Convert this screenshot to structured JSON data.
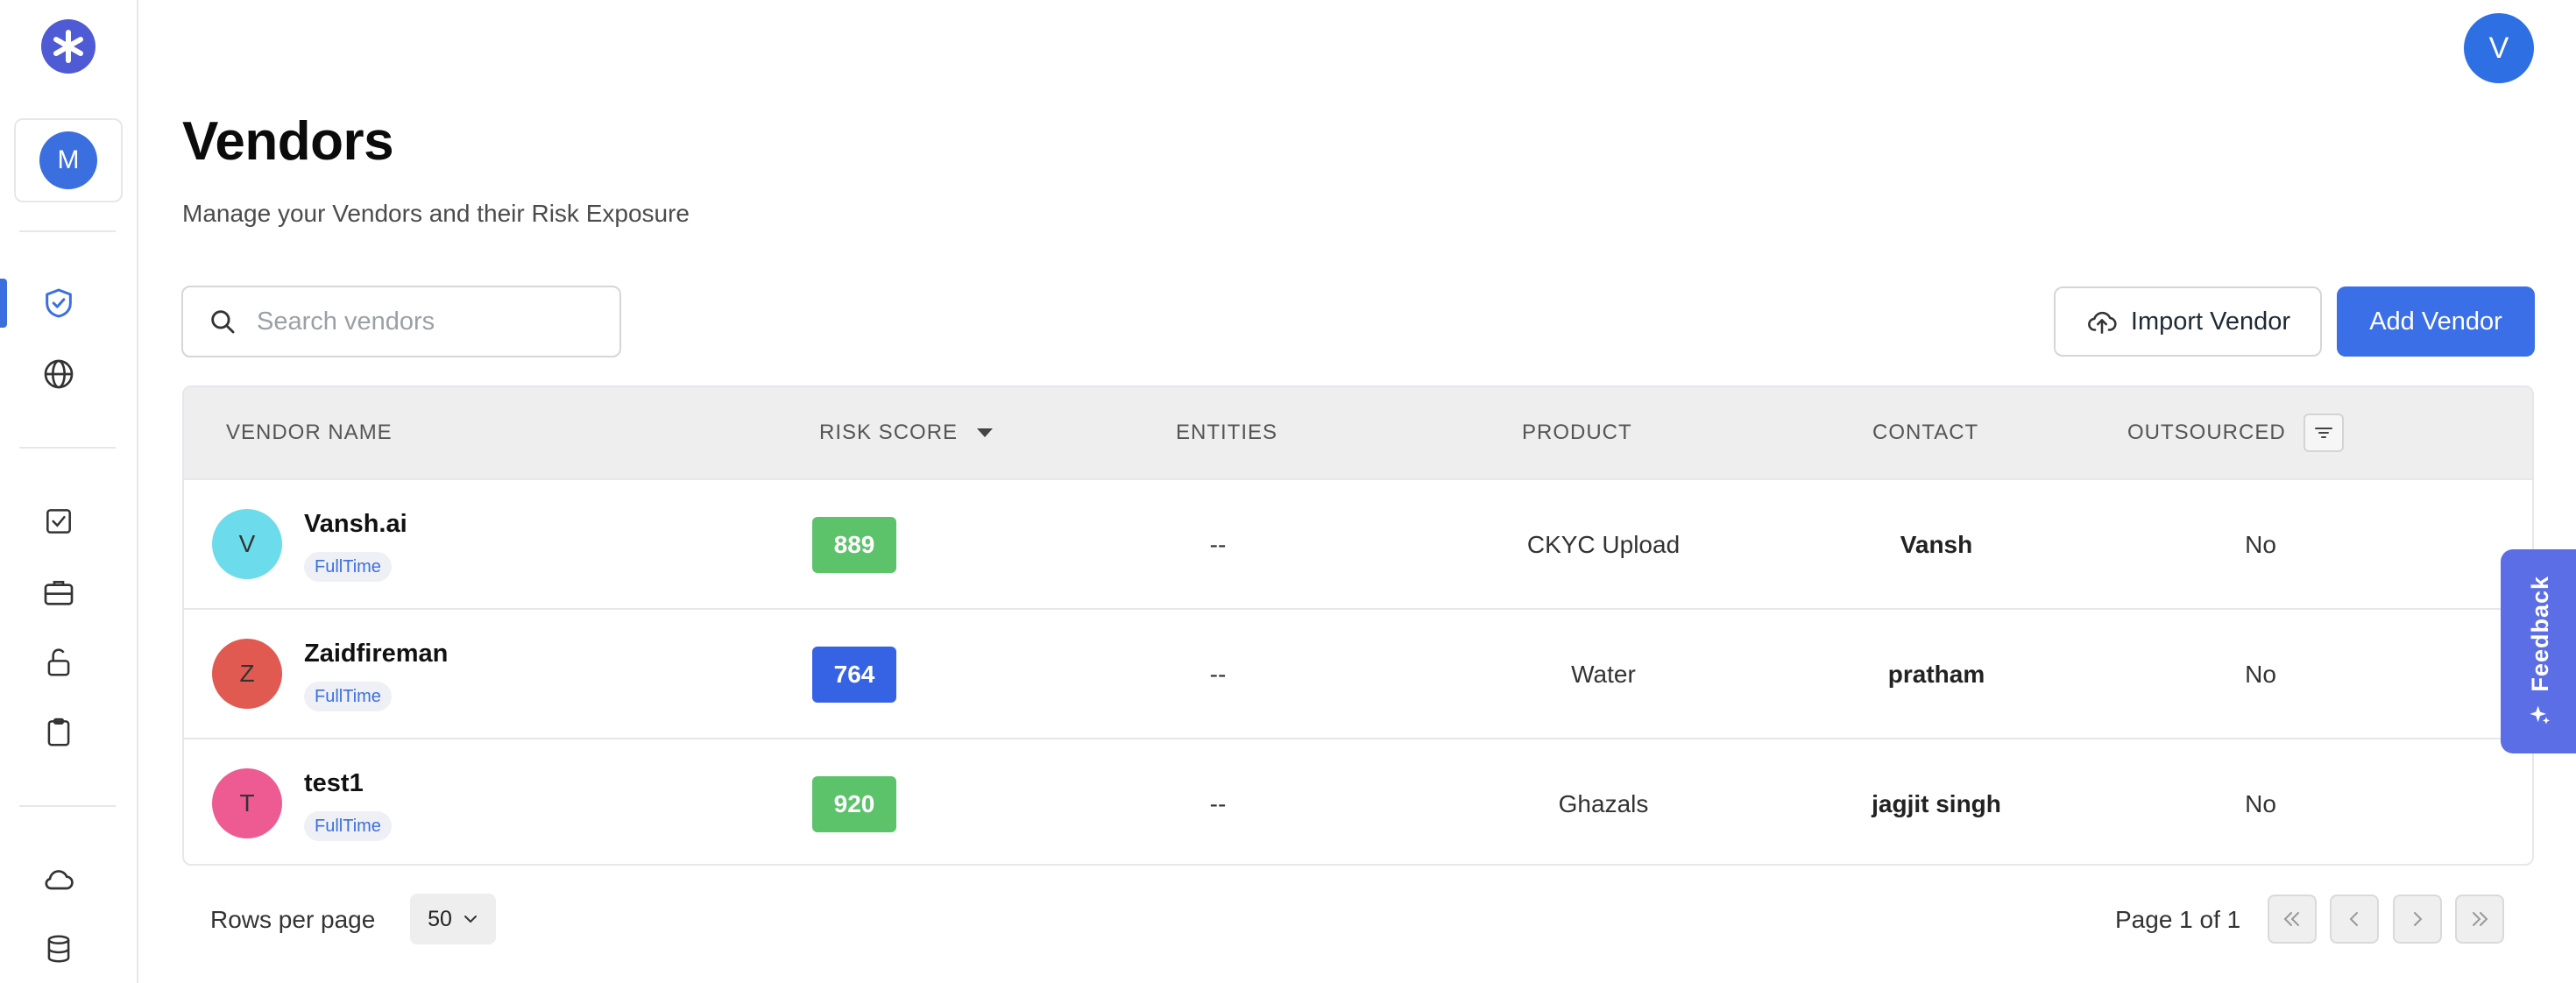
{
  "sidebar": {
    "org_avatar": "M",
    "nav_icons": [
      "shield-check-icon",
      "globe-icon",
      "checkbox-icon",
      "briefcase-icon",
      "unlock-icon",
      "clipboard-icon",
      "cloud-icon",
      "database-icon"
    ],
    "active_item": "shield-check-icon"
  },
  "user": {
    "avatar_initial": "V"
  },
  "header": {
    "title": "Vendors",
    "subtitle": "Manage your Vendors and their Risk Exposure"
  },
  "search": {
    "placeholder": "Search vendors",
    "value": ""
  },
  "actions": {
    "import_label": "Import Vendor",
    "add_label": "Add Vendor"
  },
  "table": {
    "columns": {
      "vendor_name": "VENDOR NAME",
      "risk_score": "RISK SCORE",
      "entities": "ENTITIES",
      "product": "PRODUCT",
      "contact": "CONTACT",
      "outsourced": "OUTSOURCED"
    },
    "rows": [
      {
        "initial": "V",
        "name": "Vansh.ai",
        "tag": "FullTime",
        "score": "889",
        "entities": "--",
        "product": "CKYC Upload",
        "contact": "Vansh",
        "outsourced": "No",
        "avatar_color": "#6cdcec",
        "score_color": "#5cc36b"
      },
      {
        "initial": "Z",
        "name": "Zaidfireman",
        "tag": "FullTime",
        "score": "764",
        "entities": "--",
        "product": "Water",
        "contact": "pratham",
        "outsourced": "No",
        "avatar_color": "#e05a52",
        "score_color": "#3563e4"
      },
      {
        "initial": "T",
        "name": "test1",
        "tag": "FullTime",
        "score": "920",
        "entities": "--",
        "product": "Ghazals",
        "contact": "jagjit singh",
        "outsourced": "No",
        "avatar_color": "#ee5a92",
        "score_color": "#5cc36b"
      }
    ]
  },
  "feedback": {
    "label": "Feedback"
  },
  "pagination": {
    "rows_per_page_label": "Rows per page",
    "rows_per_page_value": "50",
    "page_info": "Page 1 of 1"
  },
  "colors": {
    "accent": "#3b6fe8",
    "brand": "#4f5bd5",
    "feedback": "#5b6ee6"
  }
}
